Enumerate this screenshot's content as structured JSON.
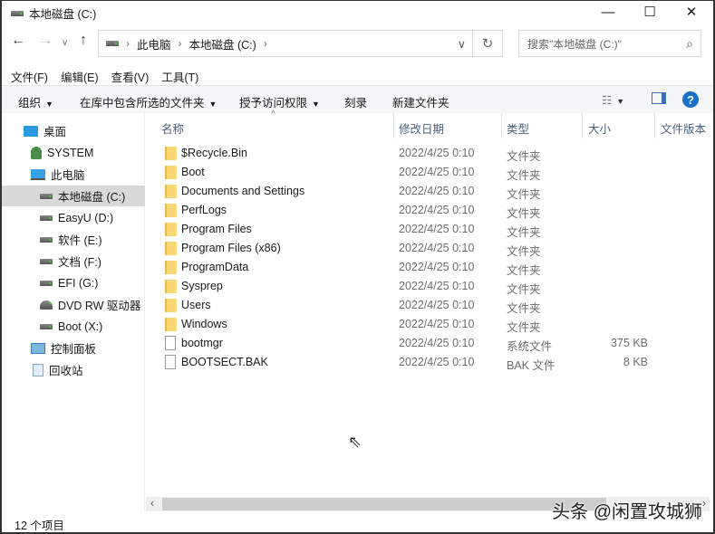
{
  "window": {
    "title": "本地磁盘 (C:)",
    "minimize": "—",
    "maximize": "☐",
    "close": "✕"
  },
  "address": {
    "path": [
      "此电脑",
      "本地磁盘 (C:)"
    ],
    "search_placeholder": "搜索\"本地磁盘 (C:)\""
  },
  "menu": [
    "文件(F)",
    "编辑(E)",
    "查看(V)",
    "工具(T)"
  ],
  "toolbar": {
    "organize": "组织",
    "include_library": "在库中包含所选的文件夹",
    "share": "授予访问权限",
    "burn": "刻录",
    "new_folder": "新建文件夹",
    "help": "?"
  },
  "sidebar": [
    {
      "label": "桌面",
      "icon": "desktop-icon"
    },
    {
      "label": "SYSTEM",
      "icon": "user-icon"
    },
    {
      "label": "此电脑",
      "icon": "computer-icon"
    },
    {
      "label": "本地磁盘 (C:)",
      "icon": "drive-icon",
      "selected": true
    },
    {
      "label": "EasyU (D:)",
      "icon": "drive-icon"
    },
    {
      "label": "软件 (E:)",
      "icon": "drive-icon"
    },
    {
      "label": "文档 (F:)",
      "icon": "drive-icon"
    },
    {
      "label": "EFI (G:)",
      "icon": "drive-icon"
    },
    {
      "label": "DVD RW 驱动器",
      "icon": "dvd-icon"
    },
    {
      "label": "Boot (X:)",
      "icon": "drive-icon"
    },
    {
      "label": "控制面板",
      "icon": "control-panel-icon"
    },
    {
      "label": "回收站",
      "icon": "recycle-bin-icon"
    }
  ],
  "columns": [
    "名称",
    "修改日期",
    "类型",
    "大小",
    "文件版本"
  ],
  "files": [
    {
      "name": "$Recycle.Bin",
      "date": "2022/4/25 0:10",
      "type": "文件夹",
      "size": "",
      "kind": "folder"
    },
    {
      "name": "Boot",
      "date": "2022/4/25 0:10",
      "type": "文件夹",
      "size": "",
      "kind": "folder"
    },
    {
      "name": "Documents and Settings",
      "date": "2022/4/25 0:10",
      "type": "文件夹",
      "size": "",
      "kind": "folder"
    },
    {
      "name": "PerfLogs",
      "date": "2022/4/25 0:10",
      "type": "文件夹",
      "size": "",
      "kind": "folder"
    },
    {
      "name": "Program Files",
      "date": "2022/4/25 0:10",
      "type": "文件夹",
      "size": "",
      "kind": "folder"
    },
    {
      "name": "Program Files (x86)",
      "date": "2022/4/25 0:10",
      "type": "文件夹",
      "size": "",
      "kind": "folder"
    },
    {
      "name": "ProgramData",
      "date": "2022/4/25 0:10",
      "type": "文件夹",
      "size": "",
      "kind": "folder"
    },
    {
      "name": "Sysprep",
      "date": "2022/4/25 0:10",
      "type": "文件夹",
      "size": "",
      "kind": "folder"
    },
    {
      "name": "Users",
      "date": "2022/4/25 0:10",
      "type": "文件夹",
      "size": "",
      "kind": "folder"
    },
    {
      "name": "Windows",
      "date": "2022/4/25 0:10",
      "type": "文件夹",
      "size": "",
      "kind": "folder"
    },
    {
      "name": "bootmgr",
      "date": "2022/4/25 0:10",
      "type": "系统文件",
      "size": "375 KB",
      "kind": "file"
    },
    {
      "name": "BOOTSECT.BAK",
      "date": "2022/4/25 0:10",
      "type": "BAK 文件",
      "size": "8 KB",
      "kind": "file"
    }
  ],
  "status": "12 个项目",
  "watermark": "头条 @闲置攻城狮"
}
